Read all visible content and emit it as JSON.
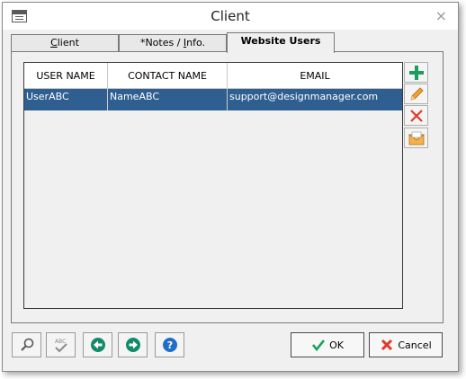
{
  "window": {
    "title": "Client",
    "close_glyph": "×"
  },
  "tabs": [
    {
      "label_first": "C",
      "label_rest": "lient",
      "full": "Client"
    },
    {
      "label_pre": "*Notes / ",
      "label_ul": "I",
      "label_post": "nfo.",
      "full": "*Notes / Info."
    },
    {
      "label": "Website Users"
    }
  ],
  "table": {
    "headers": [
      "USER NAME",
      "CONTACT NAME",
      "EMAIL"
    ],
    "rows": [
      {
        "user": "UserABC",
        "contact": "NameABC",
        "email": "support@designmanager.com"
      }
    ]
  },
  "side_actions": [
    {
      "name": "add-icon",
      "color": "#1aa05a"
    },
    {
      "name": "edit-pencil-icon",
      "color": "#f0a030"
    },
    {
      "name": "delete-icon",
      "color": "#e03a2a"
    },
    {
      "name": "email-envelope-icon",
      "color": "#f0a030"
    }
  ],
  "footer": {
    "ok_label": "OK",
    "cancel_label": "Cancel",
    "spell_abc": "ABC",
    "help_glyph": "?"
  },
  "colors": {
    "selection": "#2f5f91",
    "nav_green": "#138a6a",
    "help_blue": "#1f6fc8"
  }
}
